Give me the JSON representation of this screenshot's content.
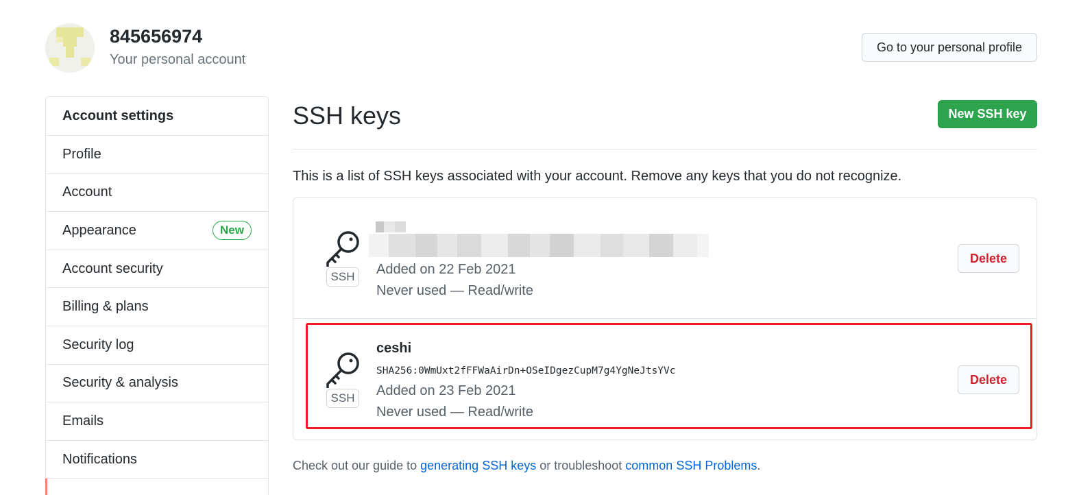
{
  "header": {
    "account_name": "845656974",
    "account_subtitle": "Your personal account",
    "profile_button": "Go to your personal profile"
  },
  "sidebar": {
    "heading": "Account settings",
    "items": [
      {
        "label": "Profile"
      },
      {
        "label": "Account"
      },
      {
        "label": "Appearance",
        "badge": "New"
      },
      {
        "label": "Account security"
      },
      {
        "label": "Billing & plans"
      },
      {
        "label": "Security log"
      },
      {
        "label": "Security & analysis"
      },
      {
        "label": "Emails"
      },
      {
        "label": "Notifications"
      }
    ]
  },
  "main": {
    "title": "SSH keys",
    "new_button": "New SSH key",
    "intro": "This is a list of SSH keys associated with your account. Remove any keys that you do not recognize.",
    "keys": [
      {
        "type_label": "SSH",
        "title": "",
        "fingerprint": "",
        "added": "Added on 22 Feb 2021",
        "usage": "Never used — Read/write",
        "delete_label": "Delete"
      },
      {
        "type_label": "SSH",
        "title": "ceshi",
        "fingerprint": "SHA256:0WmUxt2fFFWaAirDn+OSeIDgezCupM7g4YgNeJtsYVc",
        "added": "Added on 23 Feb 2021",
        "usage": "Never used — Read/write",
        "delete_label": "Delete"
      }
    ],
    "footer": {
      "prefix": "Check out our guide to ",
      "link1": "generating SSH keys",
      "middle": " or troubleshoot ",
      "link2": "common SSH Problems",
      "suffix": "."
    }
  },
  "colors": {
    "primary_green": "#2ea44f",
    "danger_red": "#cb2431",
    "link_blue": "#0366d6",
    "highlight_red": "#ee1c24",
    "sidebar_accent": "#f9826c"
  },
  "icons": [
    "avatar-identicon",
    "key-icon"
  ]
}
